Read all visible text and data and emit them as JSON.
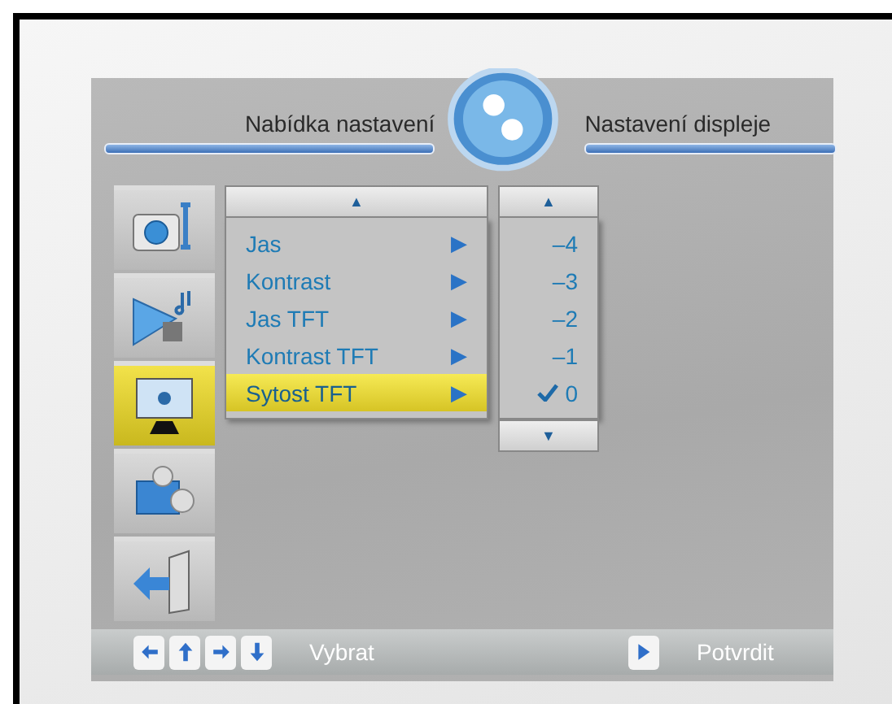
{
  "header": {
    "left_title": "Nabídka nastavení",
    "right_title": "Nastavení displeje"
  },
  "sidebar": [
    {
      "kind": "camera",
      "selected": false
    },
    {
      "kind": "sound",
      "selected": false
    },
    {
      "kind": "display",
      "selected": true
    },
    {
      "kind": "settings",
      "selected": false
    },
    {
      "kind": "exit",
      "selected": false
    }
  ],
  "menu": {
    "scroll_up": "▲",
    "items": [
      {
        "label": "Jas",
        "arrow": "▶",
        "selected": false
      },
      {
        "label": "Kontrast",
        "arrow": "▶",
        "selected": false
      },
      {
        "label": "Jas TFT",
        "arrow": "▶",
        "selected": false
      },
      {
        "label": "Kontrast TFT",
        "arrow": "▶",
        "selected": false
      },
      {
        "label": "Sytost TFT",
        "arrow": "▶",
        "selected": true
      }
    ]
  },
  "values": {
    "scroll_up": "▲",
    "scroll_down": "▼",
    "items": [
      {
        "label": "–4",
        "checked": false
      },
      {
        "label": "–3",
        "checked": false
      },
      {
        "label": "–2",
        "checked": false
      },
      {
        "label": "–1",
        "checked": false
      },
      {
        "label": "0",
        "checked": true
      }
    ]
  },
  "footer": {
    "select_label": "Vybrat",
    "confirm_label": "Potvrdit"
  }
}
